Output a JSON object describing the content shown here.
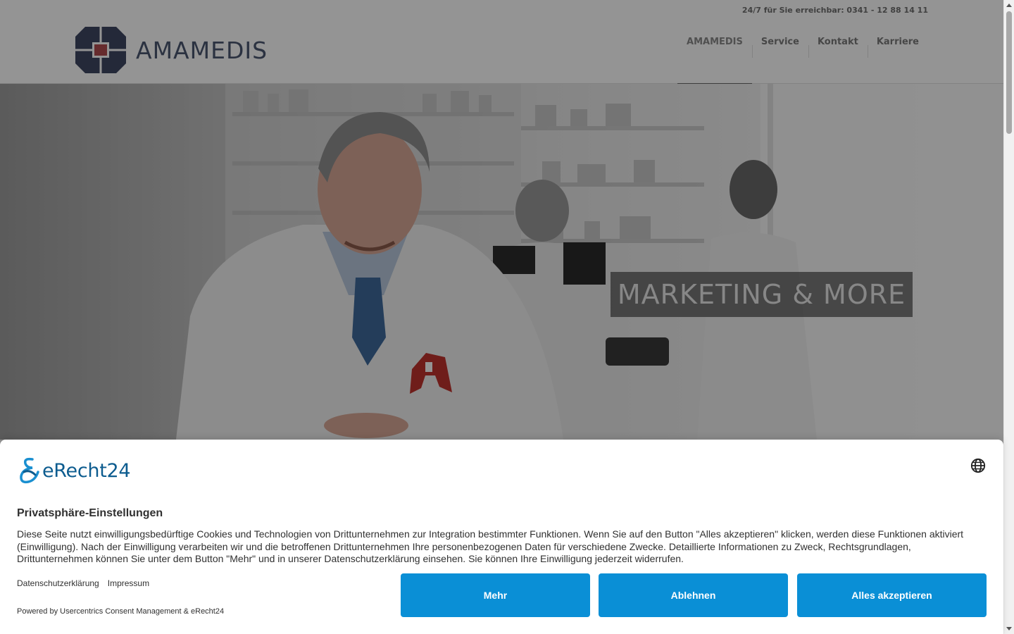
{
  "header": {
    "phone": "24/7 für Sie erreichbar: 0341 - 12 88 14 11",
    "logo_text": "AMAMEDIS",
    "nav": [
      {
        "label": "AMAMEDIS",
        "active": true
      },
      {
        "label": "Service"
      },
      {
        "label": "Kontakt"
      },
      {
        "label": "Karriere"
      }
    ]
  },
  "hero": {
    "caption": "MARKETING & MORE"
  },
  "consent": {
    "brand": "eRecht24",
    "title": "Privatsphäre-Einstellungen",
    "text": "Diese Seite nutzt einwilligungsbedürftige Cookies und Technologien von Drittunternehmen zur Integration bestimmter Funktionen. Wenn Sie auf den Button \"Alles akzeptieren\" klicken, werden diese Funktionen aktiviert (Einwilligung). Nach der Einwilligung verarbeiten wir und die betroffenen Drittunternehmen Ihre personenbezogenen Daten für verschiedene Zwecke. Detaillierte Informationen zu Zweck, Rechtsgrundlagen, Drittunternehmen können Sie unter dem Button \"Mehr\" und in unserer Datenschutzerklärung einsehen. Sie können Ihre Einwilligung jederzeit widerrufen.",
    "links": {
      "privacy": "Datenschutzerklärung",
      "imprint": "Impressum"
    },
    "powered_by": "Powered by Usercentrics Consent Management & eRecht24",
    "buttons": {
      "more": "Mehr",
      "deny": "Ablehnen",
      "accept": "Alles akzeptieren"
    },
    "accent_color": "#0a8fd6"
  },
  "icons": {
    "language": "globe-icon",
    "logo": "amamedis-logo-mark",
    "brand": "erecht24-logo-mark"
  }
}
